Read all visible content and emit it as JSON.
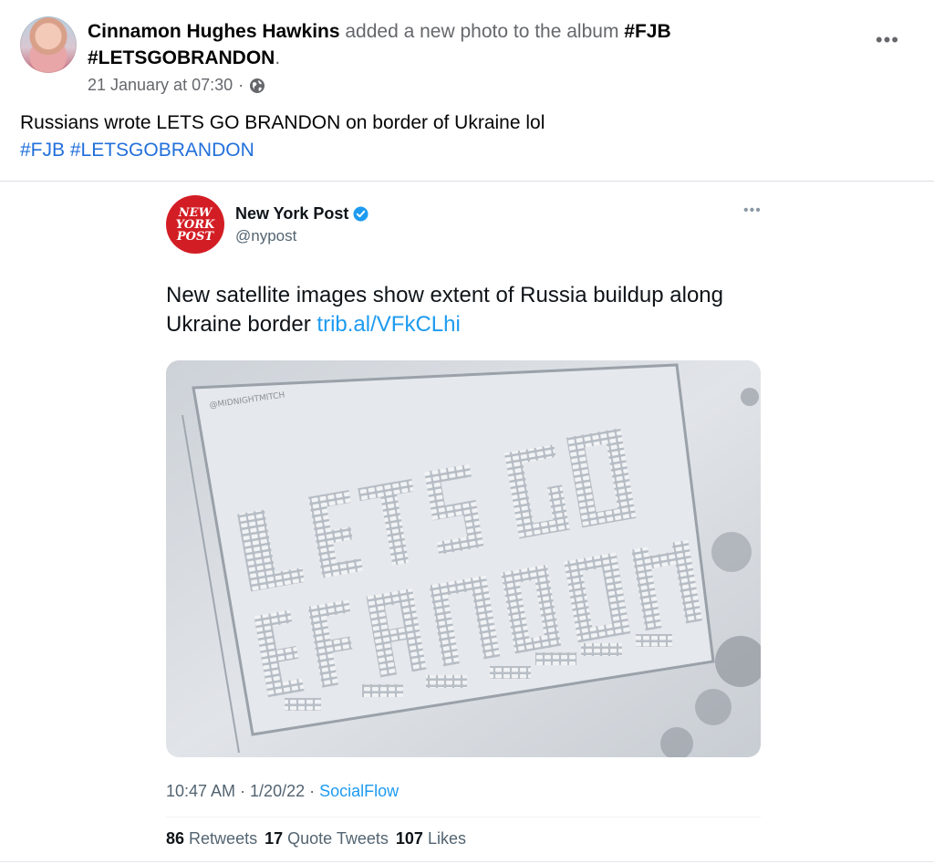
{
  "post": {
    "author": "Cinnamon Hughes Hawkins",
    "action_text": " added a new photo to the album ",
    "album": "#FJB #LETSGOBRANDON",
    "album_suffix": ".",
    "timestamp": "21 January at 07:30",
    "separator": "·",
    "text": "Russians wrote LETS GO BRANDON on border of Ukraine lol",
    "hashtags": [
      "#FJB",
      "#LETSGOBRANDON"
    ],
    "more_label": "•••"
  },
  "tweet": {
    "logo_lines": [
      "NEW",
      "YORK",
      "POST"
    ],
    "name": "New York Post",
    "handle": "@nypost",
    "more_label": "•••",
    "text": "New satellite images show extent of Russia buildup along Ukraine border ",
    "link": "trib.al/VFkCLhi",
    "image_watermark": "@MIDNIGHTMITCH",
    "time": "10:47 AM · 1/20/22 · ",
    "source": "SocialFlow",
    "stats": [
      {
        "count": "86",
        "label": "Retweets"
      },
      {
        "count": "17",
        "label": "Quote Tweets"
      },
      {
        "count": "107",
        "label": "Likes"
      }
    ]
  },
  "colors": {
    "hashtag_blue": "#216fdb",
    "twitter_link": "#1d9bf0",
    "nypost_red": "#d31d24"
  },
  "icons": {
    "privacy": "globe-icon",
    "verified": "verified-badge-icon",
    "more": "more-options-icon"
  }
}
